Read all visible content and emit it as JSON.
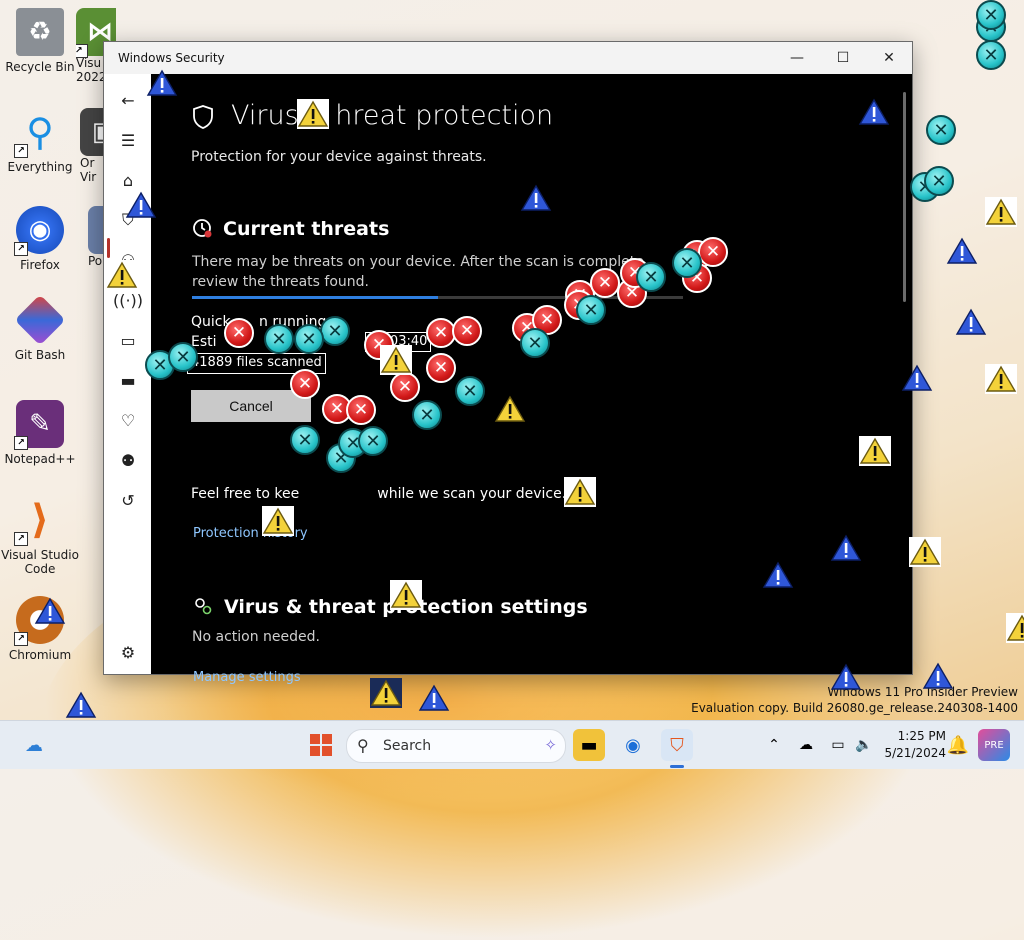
{
  "desktop": {
    "icons": [
      {
        "label": "Recycle Bin"
      },
      {
        "label": "Visu\n2022"
      },
      {
        "label": "Everything"
      },
      {
        "label": "Or\nVir"
      },
      {
        "label": "Firefox"
      },
      {
        "label": "Po"
      },
      {
        "label": "Git Bash"
      },
      {
        "label": "Notepad++"
      },
      {
        "label": "Visual Studio\nCode"
      },
      {
        "label": "Chromium"
      }
    ]
  },
  "window": {
    "title": "Windows Security",
    "controls": {
      "minimize": "—",
      "maximize": "☐",
      "close": "✕"
    },
    "page_title": "Virus & threat protection",
    "page_title_visible": "Virus",
    "page_title_tail": "hreat protection",
    "subtitle": "Protection for your device against threats.",
    "current_threats": {
      "heading": "Current threats",
      "description_line1": "There may be threats on your device. After the scan is complete,",
      "description_line2": "review the threats found.",
      "progress": 0.5,
      "scan_label": "Quick scan running...",
      "scan_label_visible": "Quick",
      "scan_label_tail": "n running",
      "estimated_label": "Esti",
      "elapsed_time": "00:03:40",
      "files_scanned": "41889  files scanned",
      "cancel_label": "Cancel",
      "feel_free": "Feel free to kee",
      "feel_free_tail": "while we scan your device.",
      "protection_history": "Protection history"
    },
    "settings": {
      "heading": "Virus & threat protection settings",
      "status": "No action needed.",
      "manage": "Manage settings"
    }
  },
  "taskbar": {
    "search_label": "Search",
    "time": "1:25 PM",
    "date": "5/21/2024",
    "widgets_icon": "weather-icon"
  },
  "watermark": {
    "line1": "Windows 11 Pro Insider Preview",
    "line2": "Evaluation copy. Build 26080.ge_release.240308-1400"
  }
}
